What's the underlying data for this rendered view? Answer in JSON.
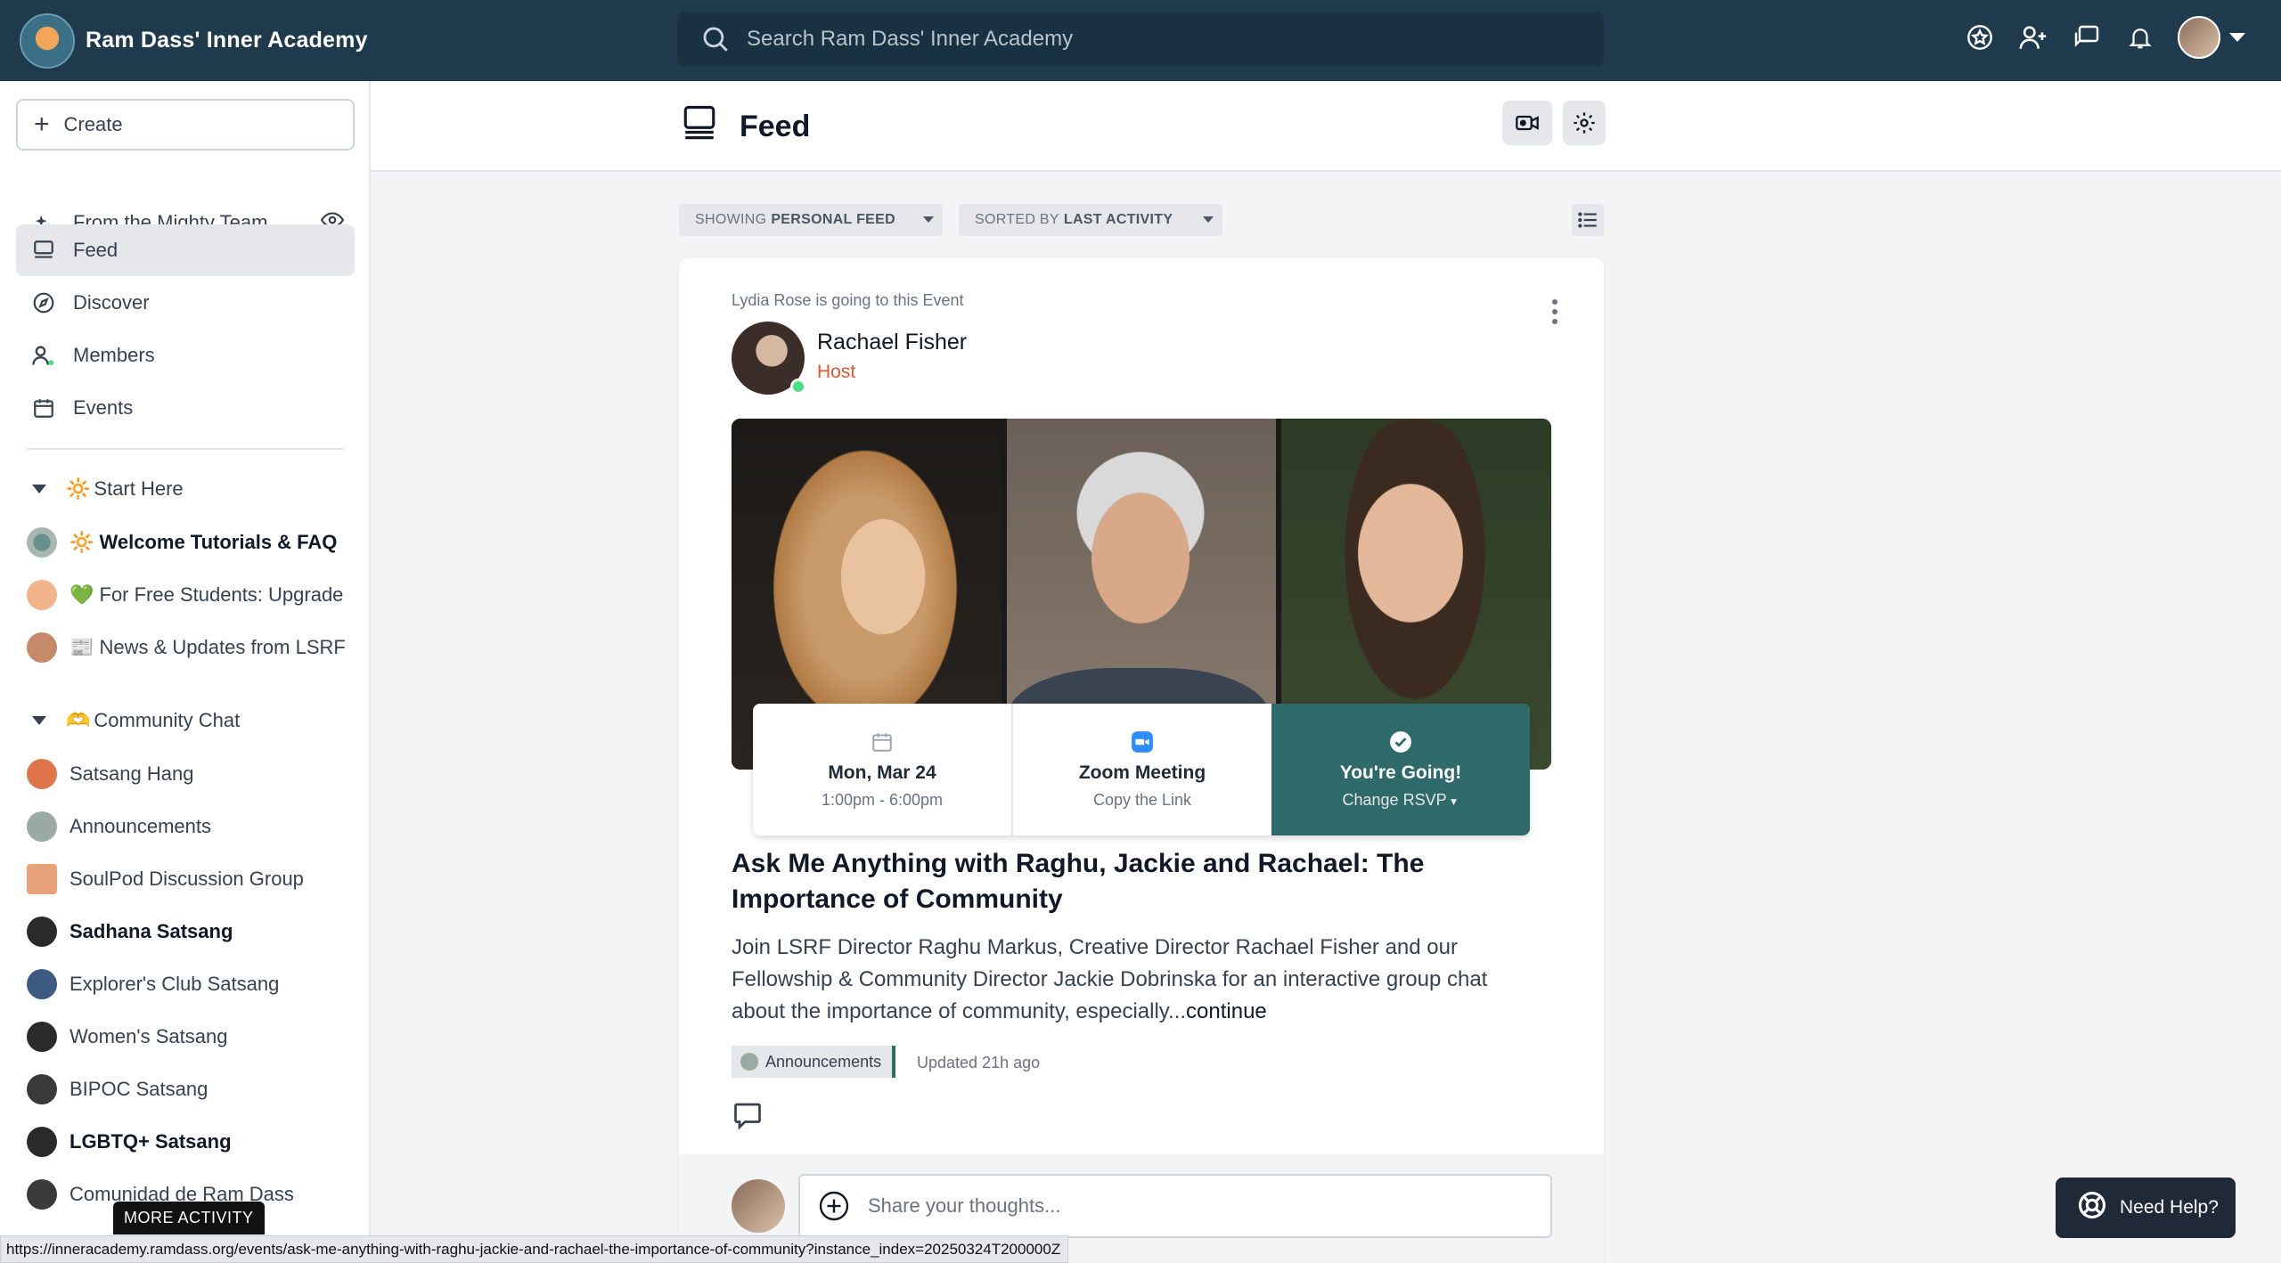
{
  "app": {
    "name": "Ram Dass' Inner Academy"
  },
  "search": {
    "placeholder": "Search Ram Dass' Inner Academy"
  },
  "sidebar": {
    "create_label": "Create",
    "nav": [
      {
        "label": "From the Mighty Team"
      },
      {
        "label": "Feed"
      },
      {
        "label": "Discover"
      },
      {
        "label": "Members"
      },
      {
        "label": "Events"
      }
    ],
    "sections": [
      {
        "label": "Start Here",
        "emoji": "🔆"
      },
      {
        "label": "Community Chat",
        "emoji": "🫶"
      }
    ],
    "spaces": [
      {
        "label": "🔆 Welcome Tutorials & FAQ",
        "bold": true
      },
      {
        "label": "💚 For Free Students: Upgrade",
        "bold": false
      },
      {
        "label": "📰 News & Updates from LSRF",
        "bold": false
      },
      {
        "label": "Satsang Hang",
        "bold": false
      },
      {
        "label": "Announcements",
        "bold": false
      },
      {
        "label": "SoulPod Discussion Group",
        "bold": false
      },
      {
        "label": "Sadhana Satsang",
        "bold": true
      },
      {
        "label": "Explorer's Club Satsang",
        "bold": false
      },
      {
        "label": "Women's Satsang",
        "bold": false
      },
      {
        "label": "BIPOC Satsang",
        "bold": false
      },
      {
        "label": "LGBTQ+ Satsang",
        "bold": true
      },
      {
        "label": "Comunidad de Ram Dass",
        "bold": false
      }
    ],
    "more_activity": "MORE ACTIVITY"
  },
  "header": {
    "title": "Feed"
  },
  "filters": {
    "showing_prefix": "SHOWING",
    "showing_value": "PERSONAL FEED",
    "sorted_prefix": "SORTED BY",
    "sorted_value": "LAST ACTIVITY"
  },
  "post": {
    "activity": "Lydia Rose is going to this Event",
    "host_name": "Rachael Fisher",
    "host_role": "Host",
    "date": "Mon, Mar 24",
    "time": "1:00pm - 6:00pm",
    "meeting": "Zoom Meeting",
    "meeting_sub": "Copy the Link",
    "rsvp": "You're Going!",
    "rsvp_sub": "Change RSVP",
    "title": "Ask Me Anything with Raghu, Jackie and Rachael: The Importance of Community",
    "body": "Join LSRF Director Raghu Markus, Creative Director Rachael Fisher and our Fellowship & Community Director Jackie Dobrinska for an interactive group chat about the importance of community, especially...",
    "continue": "continue",
    "tag": "Announcements",
    "updated": "Updated 21h ago",
    "reply_placeholder": "Share your thoughts..."
  },
  "help": {
    "label": "Need Help?"
  },
  "status_url": "https://inneracademy.ramdass.org/events/ask-me-anything-with-raghu-jackie-and-rachael-the-importance-of-community?instance_index=20250324T200000Z",
  "colors": {
    "topbar": "#1e3a4c",
    "going": "#2f6a6a",
    "host_role": "#e4572e"
  }
}
